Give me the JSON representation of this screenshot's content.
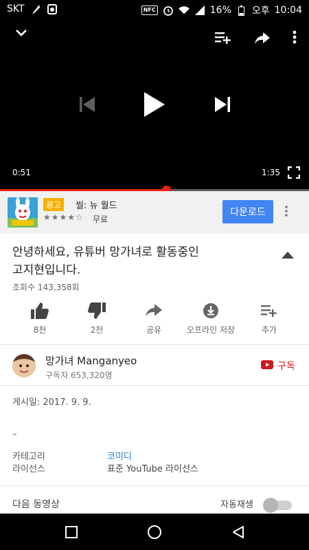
{
  "status_bar": {
    "carrier": "SKT",
    "battery": "16%",
    "ampm": "오후",
    "time": "10:04",
    "nfc_label": "NFC"
  },
  "player": {
    "elapsed": "0:51",
    "duration": "1:35",
    "progress_fraction": 0.5368,
    "icons": [
      "collapse-chevron-icon",
      "add-to-playlist-icon",
      "share-icon",
      "more-vert-icon",
      "skip-previous-icon",
      "play-icon",
      "skip-next-icon",
      "fullscreen-icon"
    ]
  },
  "ad": {
    "badge": "광고",
    "title": "씰: 뉴 월드",
    "rating_stars": "★★★★☆",
    "price": "무료",
    "download_label": "다운로드"
  },
  "video": {
    "title_line1": "안녕하세요, 유튜버 망가녀로 활동중인",
    "title_line2": "고지현입니다.",
    "views": "조회수 143,358회"
  },
  "actions": [
    {
      "label": "8천",
      "icon": "thumb-up-icon"
    },
    {
      "label": "2천",
      "icon": "thumb-down-icon"
    },
    {
      "label": "공유",
      "icon": "share-icon"
    },
    {
      "label": "오프라인 저장",
      "icon": "download-icon"
    },
    {
      "label": "추가",
      "icon": "add-to-playlist-icon"
    }
  ],
  "channel": {
    "name": "망가녀 Manganyeo",
    "subscribers": "구독자 653,320명",
    "subscribe_label": "구독"
  },
  "details": {
    "posted": "게시일: 2017. 9. 9.",
    "dash": "–",
    "category_label": "카테고리",
    "category_value": "코미디",
    "license_label": "라이선스",
    "license_value": "표준 YouTube 라이선스"
  },
  "up_next": {
    "label": "다음 동영상",
    "autoplay_label": "자동재생",
    "autoplay_on": false
  },
  "colors": {
    "accent_red": "#e62117",
    "ad_badge": "#f5b000",
    "download_button": "#4285f4",
    "link_blue": "#2a7fc7"
  }
}
